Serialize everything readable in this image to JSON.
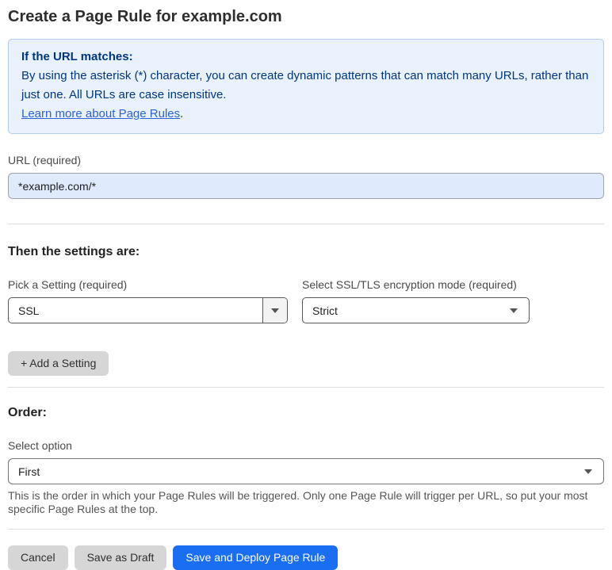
{
  "page": {
    "title": "Create a Page Rule for example.com"
  },
  "info_box": {
    "heading": "If the URL matches:",
    "body": "By using the asterisk (*) character, you can create dynamic patterns that can match many URLs, rather than just one. All URLs are case insensitive.",
    "link_label": "Learn more about Page Rules",
    "link_suffix": "."
  },
  "url_field": {
    "label": "URL (required)",
    "value": "*example.com/*"
  },
  "settings_section": {
    "heading": "Then the settings are:",
    "setting_picker": {
      "label": "Pick a Setting (required)",
      "value": "SSL"
    },
    "mode_picker": {
      "label": "Select SSL/TLS encryption mode (required)",
      "value": "Strict"
    },
    "add_setting_label": "+ Add a Setting"
  },
  "order_section": {
    "heading": "Order:",
    "label": "Select option",
    "value": "First",
    "help_text": "This is the order in which your Page Rules will be triggered. Only one Page Rule will trigger per URL, so put your most specific Page Rules at the top."
  },
  "footer": {
    "cancel_label": "Cancel",
    "save_draft_label": "Save as Draft",
    "save_deploy_label": "Save and Deploy Page Rule"
  },
  "icons": {
    "dropdown_arrow": "caret-down-icon"
  },
  "colors": {
    "accent_blue": "#1a6ef2",
    "info_background": "#e9f2fc",
    "info_border": "#aecdee",
    "info_text": "#003682",
    "link_blue": "#2c62d9",
    "input_background": "#dfeafc",
    "button_gray": "#d6d6d6"
  }
}
